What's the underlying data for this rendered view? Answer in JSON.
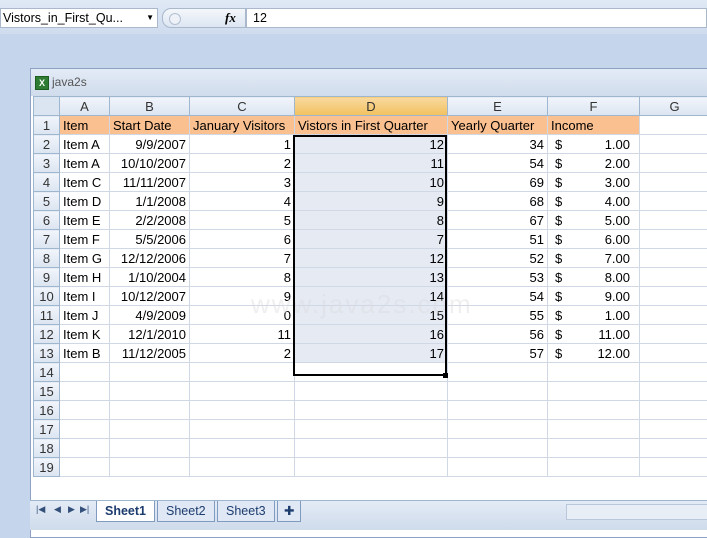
{
  "formula_bar": {
    "name_box": "Vistors_in_First_Qu...",
    "fx_label": "fx",
    "formula_value": "12"
  },
  "workbook": {
    "title": "java2s",
    "excel_icon_label": "X",
    "watermark": "www.java2s.com"
  },
  "columns": [
    "A",
    "B",
    "C",
    "D",
    "E",
    "F",
    "G"
  ],
  "rows": [
    [
      "Item",
      "Start Date",
      "January Visitors",
      "Vistors in First Quarter",
      "Yearly Quarter",
      "Income",
      ""
    ],
    [
      "Item A",
      "9/9/2007",
      "1",
      "12",
      "34",
      "1.00",
      ""
    ],
    [
      "Item A",
      "10/10/2007",
      "2",
      "11",
      "54",
      "2.00",
      ""
    ],
    [
      "Item C",
      "11/11/2007",
      "3",
      "10",
      "69",
      "3.00",
      ""
    ],
    [
      "Item D",
      "1/1/2008",
      "4",
      "9",
      "68",
      "4.00",
      ""
    ],
    [
      "Item E",
      "2/2/2008",
      "5",
      "8",
      "67",
      "5.00",
      ""
    ],
    [
      "Item F",
      "5/5/2006",
      "6",
      "7",
      "51",
      "6.00",
      ""
    ],
    [
      "Item G",
      "12/12/2006",
      "7",
      "12",
      "52",
      "7.00",
      ""
    ],
    [
      "Item H",
      "1/10/2004",
      "8",
      "13",
      "53",
      "8.00",
      ""
    ],
    [
      "Item I",
      "10/12/2007",
      "9",
      "14",
      "54",
      "9.00",
      ""
    ],
    [
      "Item J",
      "4/9/2009",
      "0",
      "15",
      "55",
      "1.00",
      ""
    ],
    [
      "Item K",
      "12/1/2010",
      "11",
      "16",
      "56",
      "11.00",
      ""
    ],
    [
      "Item B",
      "11/12/2005",
      "2",
      "17",
      "57",
      "12.00",
      ""
    ],
    [
      "",
      "",
      "",
      "",
      "",
      "",
      ""
    ],
    [
      "",
      "",
      "",
      "",
      "",
      "",
      ""
    ],
    [
      "",
      "",
      "",
      "",
      "",
      "",
      ""
    ],
    [
      "",
      "",
      "",
      "",
      "",
      "",
      ""
    ],
    [
      "",
      "",
      "",
      "",
      "",
      "",
      ""
    ],
    [
      "",
      "",
      "",
      "",
      "",
      "",
      ""
    ]
  ],
  "currency_symbol": "$",
  "sheet_tabs": [
    "Sheet1",
    "Sheet2",
    "Sheet3"
  ],
  "active_sheet": "Sheet1",
  "colors": {
    "header_fill": "#fac090",
    "selection_fill": "#e6eaf3",
    "selected_header": "#f1c15f"
  }
}
